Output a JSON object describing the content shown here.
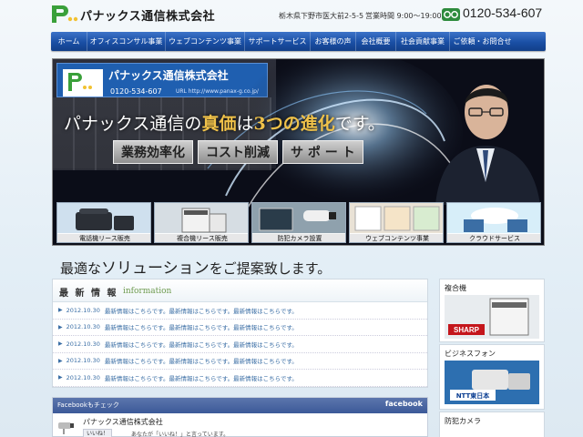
{
  "header": {
    "logo_text": "パナックス通信株式会社",
    "address": "栃木県下野市医大前2-5-5",
    "hours": "営業時間 9:00〜19:00",
    "phone": "0120-534-607"
  },
  "nav": {
    "items": [
      {
        "label": "ホーム",
        "width": 40
      },
      {
        "label": "オフィスコンサル事業",
        "width": 86
      },
      {
        "label": "ウェブコンテンツ事業",
        "width": 87
      },
      {
        "label": "サポートサービス",
        "width": 72
      },
      {
        "label": "お客様の声",
        "width": 50
      },
      {
        "label": "会社概要",
        "width": 44
      },
      {
        "label": "社会貢献事業",
        "width": 59
      },
      {
        "label": "ご依頼・お問合せ",
        "width": 71
      }
    ]
  },
  "hero": {
    "sign_text": "パナックス通信株式会社",
    "sign_phone": "0120-534-607",
    "sign_url": "URL http://www.panax-g.co.jp/",
    "headline_pre": "パナックス通信の",
    "headline_em1": "真価",
    "headline_mid": "は",
    "headline_em2": "3つの進化",
    "headline_post": "です。",
    "pills": [
      "業務効率化",
      "コスト削減",
      "サ ポ ー ト"
    ],
    "thumbs": [
      "電話機リース販売",
      "複合機リース販売",
      "防犯カメラ設置",
      "ウェブコンテンツ事業",
      "クラウドサービス"
    ]
  },
  "tagline": {
    "pre": "最適な",
    "mid": "ソリューション",
    "post": "をご提案致します。"
  },
  "news": {
    "title": "最 新 情 報",
    "subtitle": "information",
    "rows": [
      {
        "date": "2012.10.30",
        "text": "最新情報はこちらです。最新情報はこちらです。最新情報はこちらです。"
      },
      {
        "date": "2012.10.30",
        "text": "最新情報はこちらです。最新情報はこちらです。最新情報はこちらです。"
      },
      {
        "date": "2012.10.30",
        "text": "最新情報はこちらです。最新情報はこちらです。最新情報はこちらです。"
      },
      {
        "date": "2012.10.30",
        "text": "最新情報はこちらです。最新情報はこちらです。最新情報はこちらです。"
      },
      {
        "date": "2012.10.30",
        "text": "最新情報はこちらです。最新情報はこちらです。最新情報はこちらです。"
      }
    ]
  },
  "facebook": {
    "title": "Facebookもチェック",
    "brand": "facebook",
    "page_name": "パナックス通信株式会社",
    "like_button": "いいね！",
    "like_text": "あなたが「いいね！」と言っています。"
  },
  "sidebar": {
    "boxes": [
      {
        "label": "複合機",
        "brand": "SHARP"
      },
      {
        "label": "ビジネスフォン",
        "brand": "NTT東日本"
      },
      {
        "label": "防犯カメラ",
        "brand": ""
      }
    ]
  },
  "colors": {
    "nav": "#1a4fa5",
    "accent_gold": "#f0c24a",
    "facebook": "#3b5998",
    "link": "#3a6ea5"
  }
}
